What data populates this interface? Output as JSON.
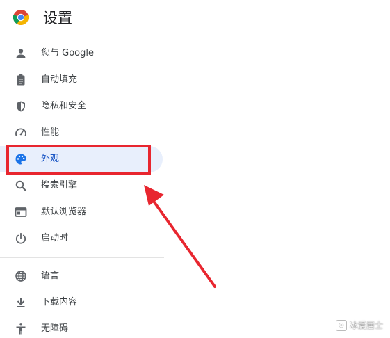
{
  "header": {
    "title": "设置",
    "logo_icon": "chrome-logo-icon"
  },
  "menu": {
    "items": [
      {
        "label": "您与 Google",
        "icon": "person-icon"
      },
      {
        "label": "自动填充",
        "icon": "clipboard-icon"
      },
      {
        "label": "隐私和安全",
        "icon": "shield-icon"
      },
      {
        "label": "性能",
        "icon": "speedometer-icon"
      },
      {
        "label": "外观",
        "icon": "palette-icon",
        "active": true
      },
      {
        "label": "搜索引擎",
        "icon": "search-icon"
      },
      {
        "label": "默认浏览器",
        "icon": "browser-window-icon"
      },
      {
        "label": "启动时",
        "icon": "power-icon"
      },
      {
        "label": "语言",
        "icon": "globe-icon"
      },
      {
        "label": "下载内容",
        "icon": "download-icon"
      },
      {
        "label": "无障碍",
        "icon": "accessibility-icon"
      }
    ]
  },
  "watermark": {
    "text": "冰爱居士"
  },
  "colors": {
    "active_bg": "#e8effc",
    "active_text": "#1a56c5",
    "annotation_red": "#e8262f"
  }
}
